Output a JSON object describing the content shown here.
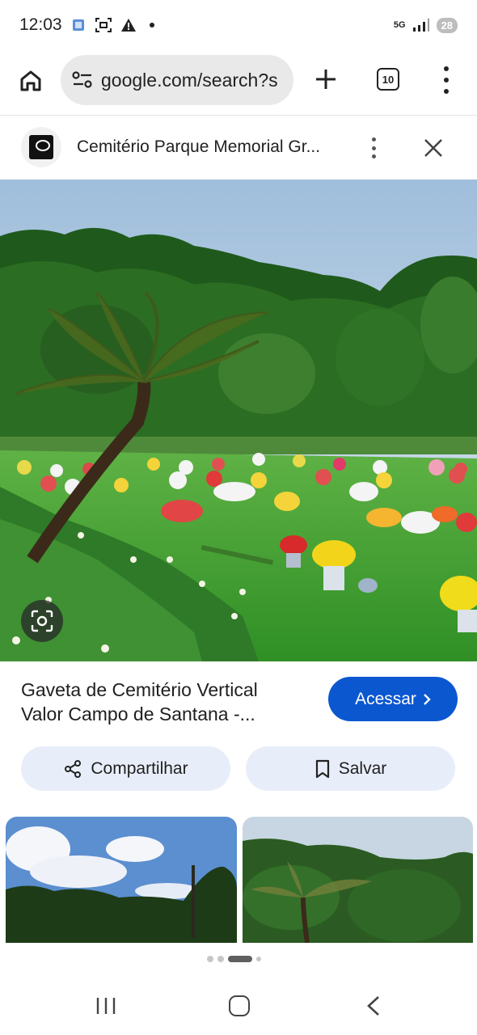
{
  "status_bar": {
    "time": "12:03",
    "network": "5G",
    "battery": "28"
  },
  "browser": {
    "url": "google.com/search?s",
    "tab_count": "10"
  },
  "source": {
    "title": "Cemitério Parque Memorial Gr..."
  },
  "result": {
    "title_line1": "Gaveta de Cemitério Vertical",
    "title_line2": "Valor Campo de Santana -...",
    "visit_label": "Acessar",
    "share_label": "Compartilhar",
    "save_label": "Salvar"
  },
  "pager": {
    "count": 4,
    "active_index": 2
  },
  "colors": {
    "accent": "#0b57d0",
    "action_bg": "#e8eef9",
    "url_bg": "#e9e9ea"
  }
}
